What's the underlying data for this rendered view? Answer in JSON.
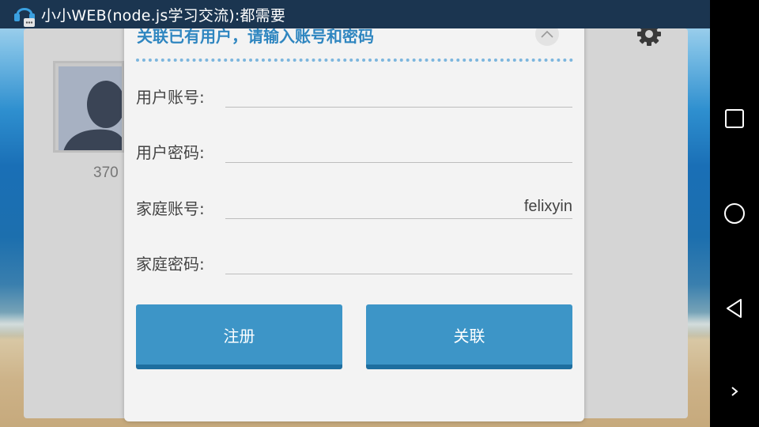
{
  "statusbar": {
    "title": "小小WEB(node.js学习交流):都需要"
  },
  "background_page": {
    "account_number_partial": "370"
  },
  "dialog": {
    "title": "关联已有用户，请输入账号和密码",
    "fields": [
      {
        "label": "用户账号:",
        "value": ""
      },
      {
        "label": "用户密码:",
        "value": ""
      },
      {
        "label": "家庭账号:",
        "value": "felixyin"
      },
      {
        "label": "家庭密码:",
        "value": ""
      }
    ],
    "buttons": {
      "register": "注册",
      "link": "关联"
    }
  },
  "icons": {
    "app": "app-logo-icon",
    "gear": "gear-icon",
    "close": "close-icon",
    "recents": "recents-icon",
    "home": "home-icon",
    "back": "back-icon",
    "more": "chevron-right-icon"
  },
  "colors": {
    "statusbar": "#1b3550",
    "accent": "#3d95c7",
    "title": "#2f86c0",
    "dialog_bg": "#f3f3f3"
  }
}
